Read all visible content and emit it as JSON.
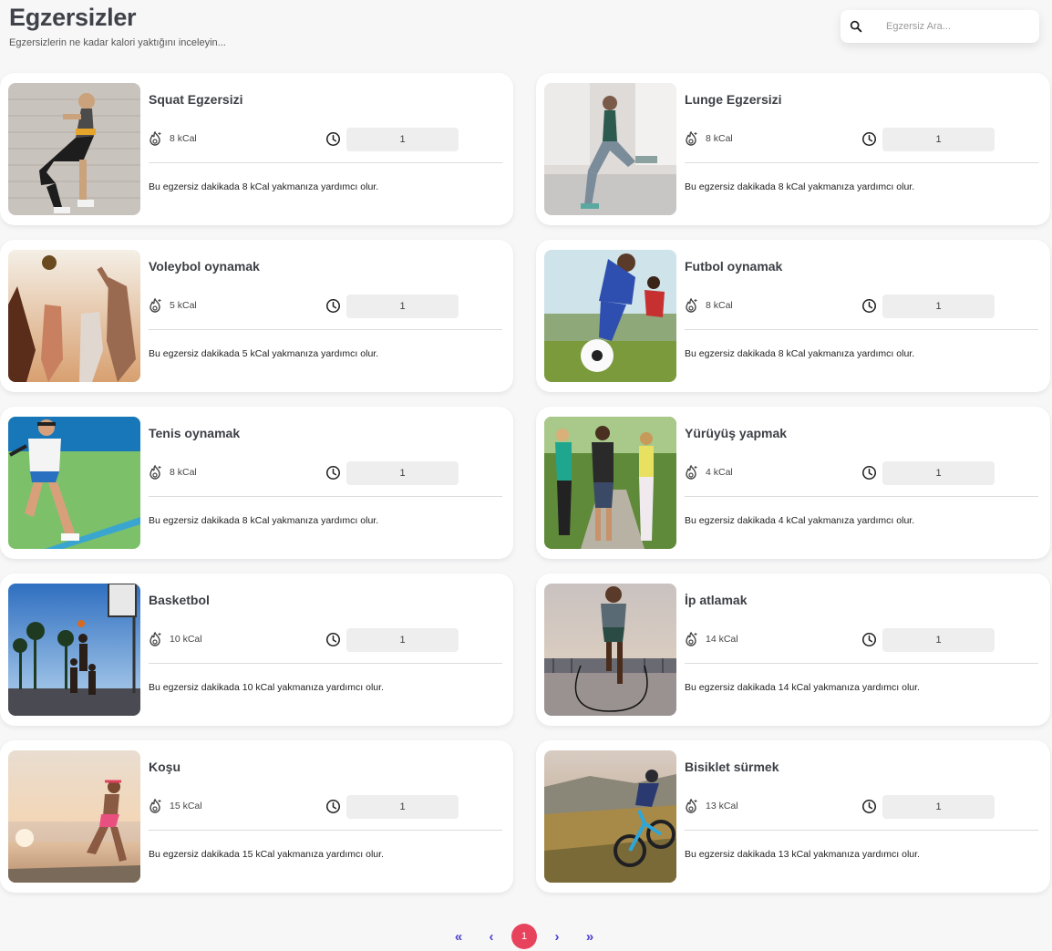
{
  "header": {
    "title": "Egzersizler",
    "subtitle": "Egzersizlerin ne kadar kalori yaktığını inceleyin..."
  },
  "search": {
    "placeholder": "Egzersiz Ara...",
    "icon": "search-icon"
  },
  "icons": {
    "calories": "flame-icon",
    "duration": "clock-icon"
  },
  "exercises": [
    {
      "title": "Squat Egzersizi",
      "kcal": "8 kCal",
      "minutes": "1",
      "description": "Bu egzersiz dakikada 8 kCal yakmanıza yardımcı olur.",
      "image": "squat"
    },
    {
      "title": "Lunge Egzersizi",
      "kcal": "8 kCal",
      "minutes": "1",
      "description": "Bu egzersiz dakikada 8 kCal yakmanıza yardımcı olur.",
      "image": "lunge"
    },
    {
      "title": "Voleybol oynamak",
      "kcal": "5 kCal",
      "minutes": "1",
      "description": "Bu egzersiz dakikada 5 kCal yakmanıza yardımcı olur.",
      "image": "volleyball"
    },
    {
      "title": "Futbol oynamak",
      "kcal": "8 kCal",
      "minutes": "1",
      "description": "Bu egzersiz dakikada 8 kCal yakmanıza yardımcı olur.",
      "image": "football"
    },
    {
      "title": "Tenis oynamak",
      "kcal": "8 kCal",
      "minutes": "1",
      "description": "Bu egzersiz dakikada 8 kCal yakmanıza yardımcı olur.",
      "image": "tennis"
    },
    {
      "title": "Yürüyüş yapmak",
      "kcal": "4 kCal",
      "minutes": "1",
      "description": "Bu egzersiz dakikada 4 kCal yakmanıza yardımcı olur.",
      "image": "walking"
    },
    {
      "title": "Basketbol",
      "kcal": "10 kCal",
      "minutes": "1",
      "description": "Bu egzersiz dakikada 10 kCal yakmanıza yardımcı olur.",
      "image": "basketball"
    },
    {
      "title": "İp atlamak",
      "kcal": "14 kCal",
      "minutes": "1",
      "description": "Bu egzersiz dakikada 14 kCal yakmanıza yardımcı olur.",
      "image": "jump-rope"
    },
    {
      "title": "Koşu",
      "kcal": "15 kCal",
      "minutes": "1",
      "description": "Bu egzersiz dakikada 15 kCal yakmanıza yardımcı olur.",
      "image": "running"
    },
    {
      "title": "Bisiklet sürmek",
      "kcal": "13 kCal",
      "minutes": "1",
      "description": "Bu egzersiz dakikada 13 kCal yakmanıza yardımcı olur.",
      "image": "cycling"
    }
  ],
  "pagination": {
    "first": "«",
    "prev": "‹",
    "current": "1",
    "next": "›",
    "last": "»",
    "accent": "#4a3fcf",
    "active_color": "#e8435c"
  }
}
